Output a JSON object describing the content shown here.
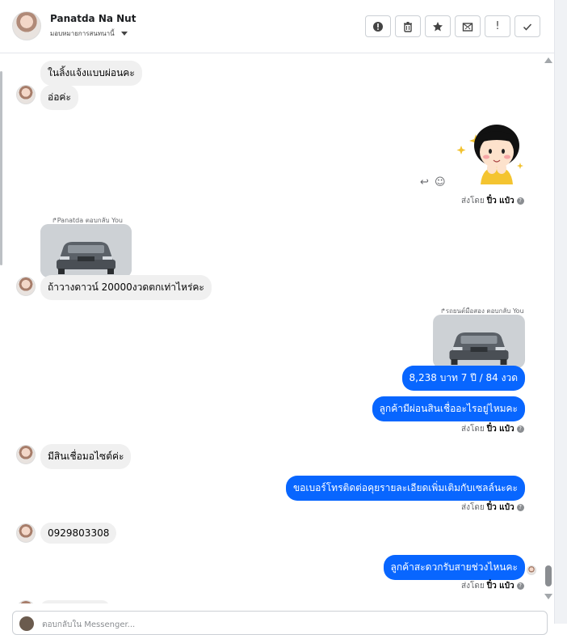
{
  "header": {
    "name": "Panatda Na Nut",
    "subtitle": "มอบหมายการสนทนานี้"
  },
  "toolbar": {
    "buttons": [
      {
        "icon": "alert-circle-icon"
      },
      {
        "icon": "trash-icon"
      },
      {
        "icon": "star-icon"
      },
      {
        "icon": "mail-x-icon"
      },
      {
        "icon": "exclamation-icon",
        "label": "!"
      },
      {
        "icon": "check-icon"
      }
    ]
  },
  "messages": {
    "m1": "ในลิ้งแจ้งแบบผ่อนคะ",
    "m2": "อ่อค่ะ",
    "m3_reply_header": "Panatda ตอบกลับ You",
    "m3": "ถ้าวางดาวน์ 20000งวดตกเท่าไหร่คะ",
    "m4_reply_header": "รถยนต์มือสอง ตอบกลับ You",
    "m4": "8,238 บาท  7 ปี / 84 งวด",
    "m5": "ลูกค้ามีผ่อนสินเชื่ออะไรอยู่ไหมคะ",
    "m6": "มีสินเชื่อมอไซต์ค่ะ",
    "m7": "ขอเบอร์โทรติดต่อคุยรายละเอียดเพิ่มเติมกับเซลล์นะคะ",
    "m8": "0929803308",
    "m9": "ลูกค้าสะดวกรับสายช่วงไหนคะ"
  },
  "sent_by": {
    "prefix": "ส่งโดย",
    "agent": "ปิ๋ว แป๋ว",
    "info": "?"
  },
  "composer": {
    "placeholder": "ตอบกลับใน Messenger..."
  },
  "colors": {
    "outgoing_bubble": "#0866ff",
    "incoming_bubble": "#f0f0f0"
  }
}
